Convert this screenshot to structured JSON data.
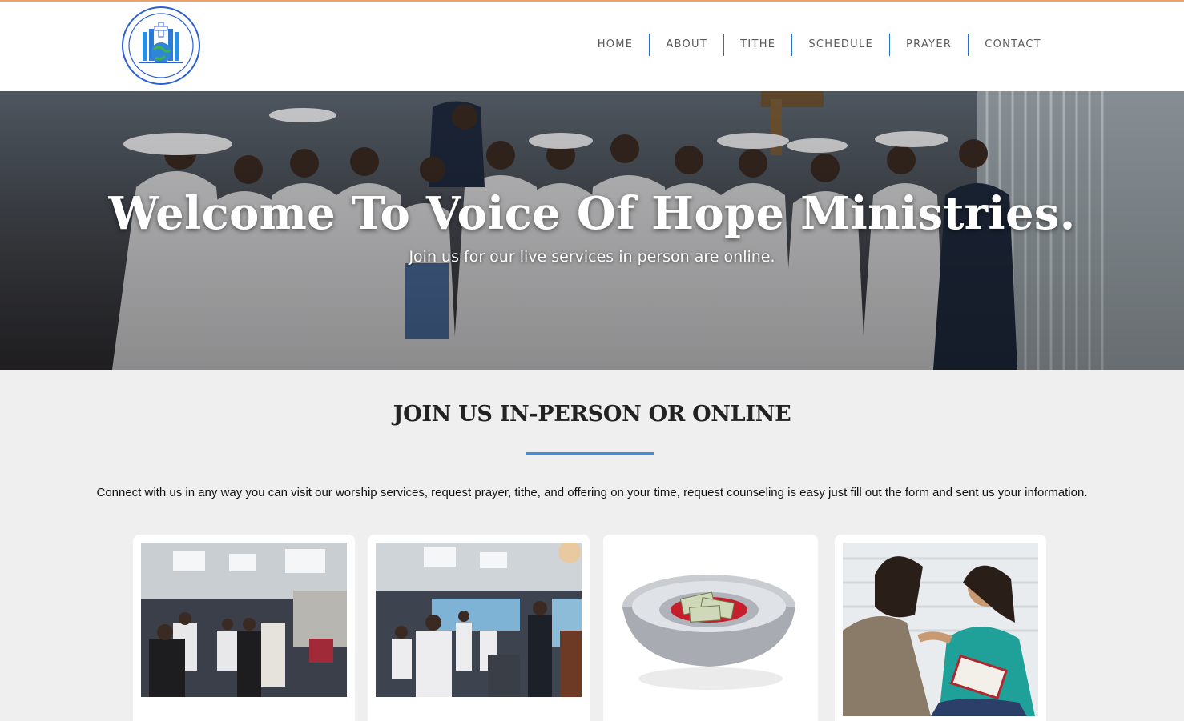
{
  "header": {
    "logo_text": "VOICE OF HOPE MINISTRIES INC",
    "nav": [
      "HOME",
      "ABOUT",
      "TITHE",
      "SCHEDULE",
      "PRAYER",
      "CONTACT"
    ]
  },
  "hero": {
    "title": "Welcome To Voice Of Hope Ministries.",
    "subtitle": "Join us for our live services in person are online."
  },
  "section": {
    "title": "JOIN US IN-PERSON OR ONLINE",
    "description": "Connect with us in any way you can visit our worship services, request prayer, tithe, and offering on your time, request counseling is easy just fill out the form and sent us your information."
  },
  "cards": [
    {
      "image": "worship-service-photo"
    },
    {
      "image": "congregation-prayer-photo"
    },
    {
      "image": "offering-plate-photo"
    },
    {
      "image": "counseling-photo"
    }
  ],
  "colors": {
    "accent": "#3d8ee3",
    "nav_separator": "#2a6fc9",
    "top_line": "#e8a36c",
    "page_bg": "#efefef"
  }
}
